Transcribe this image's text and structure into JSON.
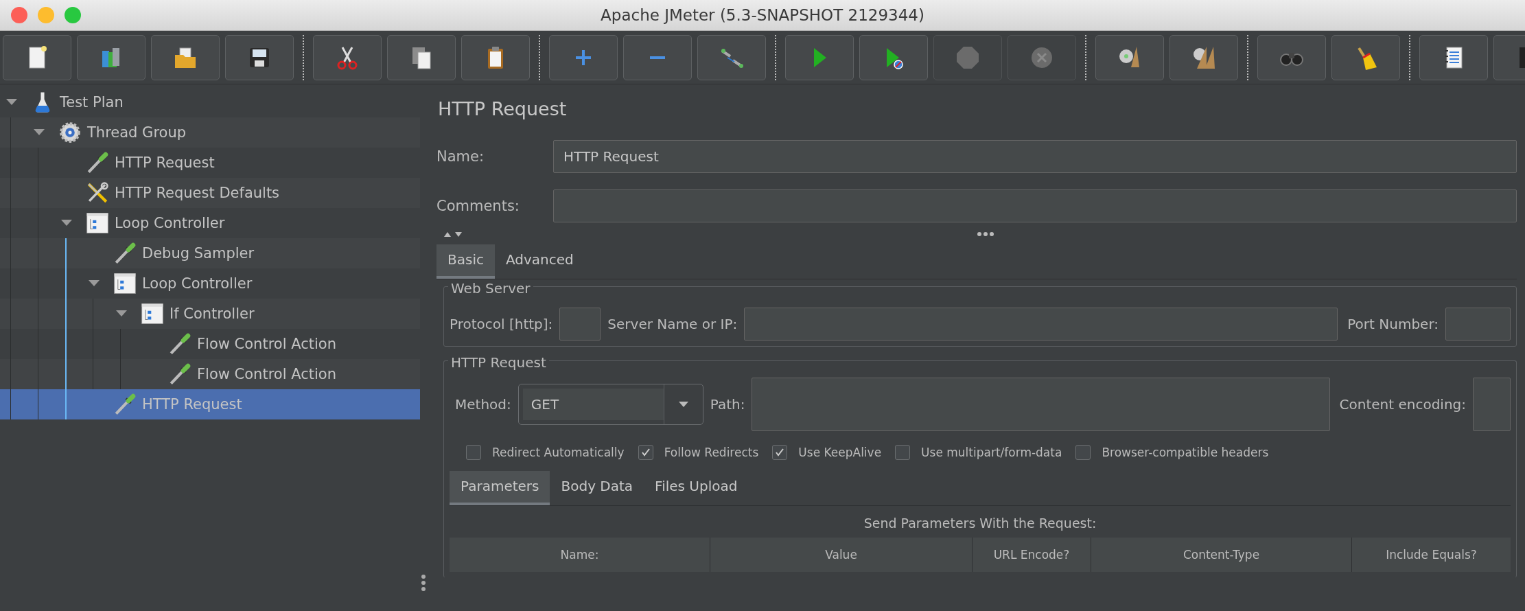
{
  "window": {
    "title": "Apache JMeter (5.3-SNAPSHOT 2129344)"
  },
  "toolbar": {
    "groups": [
      [
        {
          "kind": "new",
          "disabled": false
        },
        {
          "kind": "templates",
          "disabled": false
        },
        {
          "kind": "open",
          "disabled": false
        },
        {
          "kind": "save",
          "disabled": false
        }
      ],
      [
        {
          "kind": "cut",
          "disabled": false
        },
        {
          "kind": "copy",
          "disabled": false
        },
        {
          "kind": "paste",
          "disabled": false
        }
      ],
      [
        {
          "kind": "add",
          "disabled": false
        },
        {
          "kind": "remove",
          "disabled": false
        },
        {
          "kind": "toggle",
          "disabled": false
        }
      ],
      [
        {
          "kind": "start",
          "disabled": false
        },
        {
          "kind": "start-no-pauses",
          "disabled": false
        },
        {
          "kind": "stop",
          "disabled": true
        },
        {
          "kind": "shutdown",
          "disabled": true
        }
      ],
      [
        {
          "kind": "clear",
          "disabled": false
        },
        {
          "kind": "clear-all",
          "disabled": false
        }
      ],
      [
        {
          "kind": "search",
          "disabled": false
        },
        {
          "kind": "reset-search",
          "disabled": false
        }
      ],
      [
        {
          "kind": "function-helper",
          "disabled": false
        },
        {
          "kind": "help",
          "disabled": false
        }
      ]
    ]
  },
  "tree": [
    {
      "label": "Test Plan",
      "kind": "test-plan",
      "expanded": true,
      "selected": false,
      "children": [
        {
          "label": "Thread Group",
          "kind": "thread-group",
          "expanded": true,
          "selected": false,
          "children": [
            {
              "label": "HTTP Request",
              "kind": "sampler",
              "selected": false
            },
            {
              "label": "HTTP Request Defaults",
              "kind": "config",
              "selected": false
            },
            {
              "label": "Loop Controller",
              "kind": "controller",
              "expanded": true,
              "selected": false,
              "children": [
                {
                  "label": "Debug Sampler",
                  "kind": "sampler",
                  "selected": false
                },
                {
                  "label": "Loop Controller",
                  "kind": "controller",
                  "expanded": true,
                  "selected": false,
                  "children": [
                    {
                      "label": "If Controller",
                      "kind": "controller",
                      "expanded": true,
                      "selected": false,
                      "children": [
                        {
                          "label": "Flow Control Action",
                          "kind": "sampler",
                          "selected": false
                        },
                        {
                          "label": "Flow Control Action",
                          "kind": "sampler",
                          "selected": false
                        }
                      ]
                    }
                  ]
                },
                {
                  "label": "HTTP Request",
                  "kind": "sampler",
                  "selected": true
                }
              ]
            }
          ]
        }
      ]
    }
  ],
  "editor": {
    "title": "HTTP Request",
    "name_label": "Name:",
    "name_value": "HTTP Request",
    "comments_label": "Comments:",
    "tabs": [
      {
        "label": "Basic",
        "selected": true
      },
      {
        "label": "Advanced",
        "selected": false
      }
    ],
    "web_server": {
      "legend": "Web Server",
      "protocol_label": "Protocol [http]:",
      "server_label": "Server Name or IP:",
      "port_label": "Port Number:"
    },
    "http_request": {
      "legend": "HTTP Request",
      "method_label": "Method:",
      "method_value": "GET",
      "path_label": "Path:",
      "encoding_label": "Content encoding:",
      "options": [
        {
          "label": "Redirect Automatically",
          "checked": false
        },
        {
          "label": "Follow Redirects",
          "checked": true
        },
        {
          "label": "Use KeepAlive",
          "checked": true
        },
        {
          "label": "Use multipart/form-data",
          "checked": false
        },
        {
          "label": "Browser-compatible headers",
          "checked": false
        }
      ],
      "tabs": [
        {
          "label": "Parameters",
          "selected": true
        },
        {
          "label": "Body Data",
          "selected": false
        },
        {
          "label": "Files Upload",
          "selected": false
        }
      ],
      "caption": "Send Parameters With the Request:",
      "columns": [
        "Name:",
        "Value",
        "URL Encode?",
        "Content-Type",
        "Include Equals?"
      ]
    }
  }
}
